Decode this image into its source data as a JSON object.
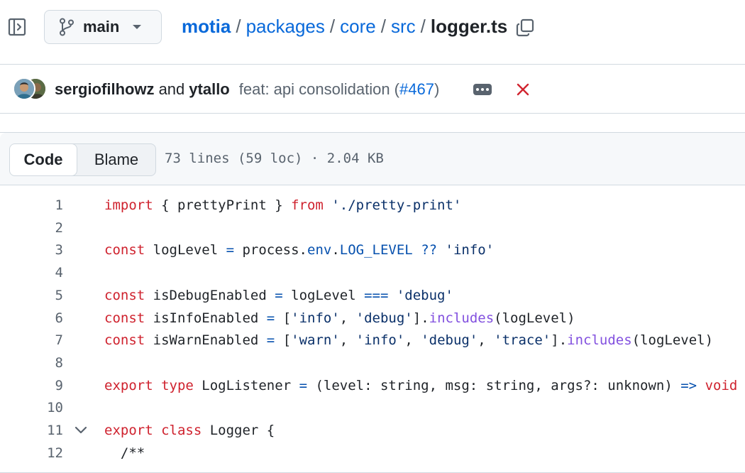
{
  "branch": {
    "name": "main"
  },
  "breadcrumb": {
    "repo": "motia",
    "parts": [
      "packages",
      "core",
      "src"
    ],
    "file": "logger.ts",
    "separator": "/"
  },
  "commit": {
    "author1": "sergiofilhowz",
    "and": "and",
    "author2": "ytallo",
    "message_prefix": "feat: api consolidation (",
    "pr": "#467",
    "message_suffix": ")",
    "status": "failure"
  },
  "file_view": {
    "tabs": [
      "Code",
      "Blame"
    ],
    "active_tab": "Code",
    "meta": "73 lines (59 loc) · 2.04 KB"
  },
  "code": {
    "lines": [
      {
        "n": "1",
        "tokens": [
          [
            "kw",
            "import"
          ],
          [
            "p",
            " { prettyPrint } "
          ],
          [
            "kw",
            "from"
          ],
          [
            "p",
            " "
          ],
          [
            "str",
            "'./pretty-print'"
          ]
        ]
      },
      {
        "n": "2",
        "tokens": []
      },
      {
        "n": "3",
        "tokens": [
          [
            "kw",
            "const"
          ],
          [
            "p",
            " logLevel "
          ],
          [
            "op",
            "="
          ],
          [
            "p",
            " process."
          ],
          [
            "con",
            "env"
          ],
          [
            "p",
            "."
          ],
          [
            "con",
            "LOG_LEVEL"
          ],
          [
            "p",
            " "
          ],
          [
            "op",
            "??"
          ],
          [
            "p",
            " "
          ],
          [
            "str",
            "'info'"
          ]
        ]
      },
      {
        "n": "4",
        "tokens": []
      },
      {
        "n": "5",
        "tokens": [
          [
            "kw",
            "const"
          ],
          [
            "p",
            " isDebugEnabled "
          ],
          [
            "op",
            "="
          ],
          [
            "p",
            " logLevel "
          ],
          [
            "op",
            "==="
          ],
          [
            "p",
            " "
          ],
          [
            "str",
            "'debug'"
          ]
        ]
      },
      {
        "n": "6",
        "tokens": [
          [
            "kw",
            "const"
          ],
          [
            "p",
            " isInfoEnabled "
          ],
          [
            "op",
            "="
          ],
          [
            "p",
            " ["
          ],
          [
            "str",
            "'info'"
          ],
          [
            "p",
            ", "
          ],
          [
            "str",
            "'debug'"
          ],
          [
            "p",
            "]."
          ],
          [
            "fn",
            "includes"
          ],
          [
            "p",
            "(logLevel)"
          ]
        ]
      },
      {
        "n": "7",
        "tokens": [
          [
            "kw",
            "const"
          ],
          [
            "p",
            " isWarnEnabled "
          ],
          [
            "op",
            "="
          ],
          [
            "p",
            " ["
          ],
          [
            "str",
            "'warn'"
          ],
          [
            "p",
            ", "
          ],
          [
            "str",
            "'info'"
          ],
          [
            "p",
            ", "
          ],
          [
            "str",
            "'debug'"
          ],
          [
            "p",
            ", "
          ],
          [
            "str",
            "'trace'"
          ],
          [
            "p",
            "]."
          ],
          [
            "fn",
            "includes"
          ],
          [
            "p",
            "(logLevel)"
          ]
        ]
      },
      {
        "n": "8",
        "tokens": []
      },
      {
        "n": "9",
        "tokens": [
          [
            "kw",
            "export"
          ],
          [
            "p",
            " "
          ],
          [
            "kw",
            "type"
          ],
          [
            "p",
            " LogListener "
          ],
          [
            "op",
            "="
          ],
          [
            "p",
            " (level: string, msg: string, args?: unknown) "
          ],
          [
            "op",
            "=>"
          ],
          [
            "p",
            " "
          ],
          [
            "kw",
            "void"
          ]
        ]
      },
      {
        "n": "10",
        "tokens": []
      },
      {
        "n": "11",
        "fold": true,
        "tokens": [
          [
            "kw",
            "export"
          ],
          [
            "p",
            " "
          ],
          [
            "kw",
            "class"
          ],
          [
            "p",
            " Logger {"
          ]
        ]
      },
      {
        "n": "12",
        "tokens": [
          [
            "p",
            "  /**"
          ]
        ]
      }
    ]
  },
  "icons": {
    "sidebar_toggle": "sidebar-expand-icon",
    "branch": "git-branch-icon",
    "caret": "triangle-down-icon",
    "copy": "copy-icon",
    "more": "kebab-horizontal-icon",
    "status": "x-icon",
    "fold": "chevron-down-icon"
  },
  "colors": {
    "link": "#0969da",
    "keyword": "#cf222e",
    "string": "#0a3069",
    "function": "#8250df",
    "constant": "#0550ae",
    "status_fail": "#d1242f"
  }
}
